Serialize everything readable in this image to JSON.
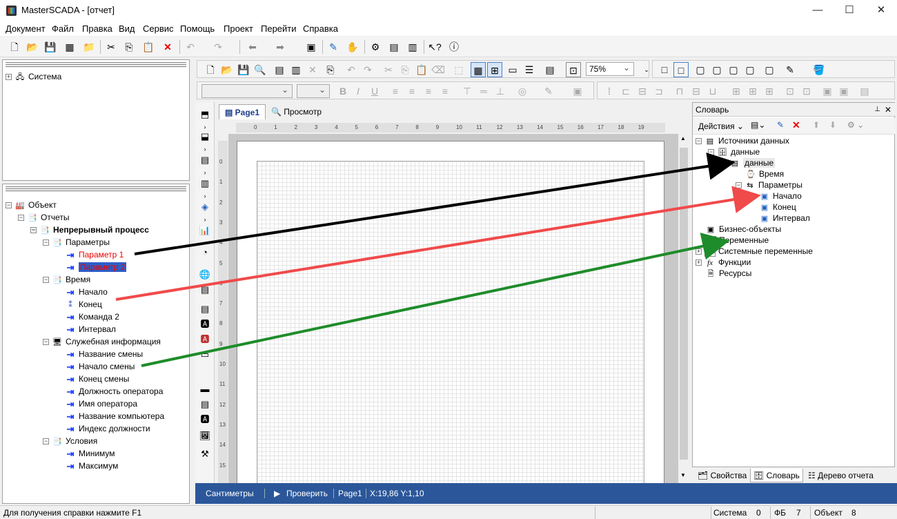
{
  "window": {
    "title": "MasterSCADA - [отчет]",
    "minimize": "—",
    "maximize": "☐",
    "close": "✕"
  },
  "menu": [
    "Документ",
    "Файл",
    "Правка",
    "Вид",
    "Сервис",
    "Помощь",
    "Проект",
    "Перейти",
    "Справка"
  ],
  "toolbar_icons": [
    "new-icon",
    "open-icon",
    "save-icon",
    "save-all-icon",
    "open-folder-icon",
    "cut-icon",
    "copy-icon",
    "paste-icon",
    "delete-icon",
    "undo-icon",
    "redo-icon",
    "back-icon",
    "forward-icon",
    "window-icon",
    "pencil-icon",
    "hand-icon",
    "gear-run-icon",
    "report-icon",
    "report2-icon",
    "help-cursor-icon",
    "info-icon"
  ],
  "system_tree": {
    "root_label": "Система"
  },
  "object_tree": {
    "root": "Объект",
    "reports": "Отчеты",
    "process": "Непрерывный процесс",
    "params_folder": "Параметры",
    "param1": "Параметр 1",
    "param2": "Параметр 2",
    "time_folder": "Время",
    "time_items": [
      "Начало",
      "Конец",
      "Команда 2",
      "Интервал"
    ],
    "service_folder": "Служебная информация",
    "service_items": [
      "Название смены",
      "Начало смены",
      "Конец смены",
      "Должность оператора",
      "Имя оператора",
      "Название компьютера",
      "Индекс должности"
    ],
    "cond_folder": "Условия",
    "cond_items": [
      "Минимум",
      "Максимум"
    ]
  },
  "designer": {
    "zoom": "75%",
    "tabs": {
      "page": "Page1",
      "preview": "Просмотр"
    },
    "ruler_marks": [
      "0",
      "1",
      "2",
      "3",
      "4",
      "5",
      "6",
      "7",
      "8",
      "9",
      "10",
      "11",
      "12",
      "13",
      "14",
      "15",
      "16",
      "17",
      "18",
      "19"
    ],
    "vruler_marks": [
      "0",
      "1",
      "2",
      "3",
      "4",
      "5",
      "6",
      "7",
      "8",
      "9",
      "10",
      "11",
      "12",
      "13",
      "14",
      "15"
    ],
    "status": {
      "units": "Сантиметры",
      "check": "Проверить",
      "page": "Page1",
      "coords": "X:19,86 Y:1,10"
    }
  },
  "dictionary": {
    "header": "Словарь",
    "actions": "Действия",
    "pin": "📌",
    "close": "✕",
    "data_sources": "Источники данных",
    "data1": "данные",
    "data2": "данные",
    "time": "Время",
    "params": "Параметры",
    "start": "Начало",
    "end": "Конец",
    "interval": "Интервал",
    "business": "Бизнес-объекты",
    "variables": "Переменные",
    "system_vars": "Системные переменные",
    "functions": "Функции",
    "resources": "Ресурсы",
    "tabs": {
      "props": "Свойства",
      "dict": "Словарь",
      "tree": "Дерево отчета"
    }
  },
  "status_bar": {
    "help": "Для получения справки нажмите F1",
    "system_label": "Система",
    "system_val": "0",
    "fb_label": "ФБ",
    "fb_val": "7",
    "obj_label": "Объект",
    "obj_val": "8"
  },
  "arrow_colors": {
    "black": "#000000",
    "red": "#f04a4a",
    "green": "#1e8c2a"
  }
}
